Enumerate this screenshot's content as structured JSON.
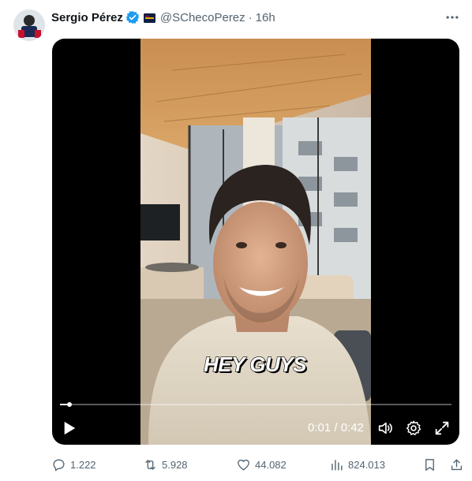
{
  "author": {
    "display_name": "Sergio Pérez",
    "handle": "@SChecoPerez",
    "separator": "·",
    "time_ago": "16h",
    "verified": true
  },
  "video": {
    "caption": "HEY GUYS",
    "time_display": "0:01 / 0:42",
    "progress": 0.024
  },
  "actions": {
    "replies": "1.222",
    "reposts": "5.928",
    "likes": "44.082",
    "views": "824.013"
  },
  "colors": {
    "verified_blue": "#1d9bf0",
    "muted_text": "#536471"
  },
  "icons": [
    "more-icon",
    "verified-icon",
    "team-flag-icon",
    "play-icon",
    "volume-icon",
    "settings-icon",
    "fullscreen-icon",
    "reply-icon",
    "repost-icon",
    "like-icon",
    "views-icon",
    "bookmark-icon",
    "share-icon"
  ]
}
